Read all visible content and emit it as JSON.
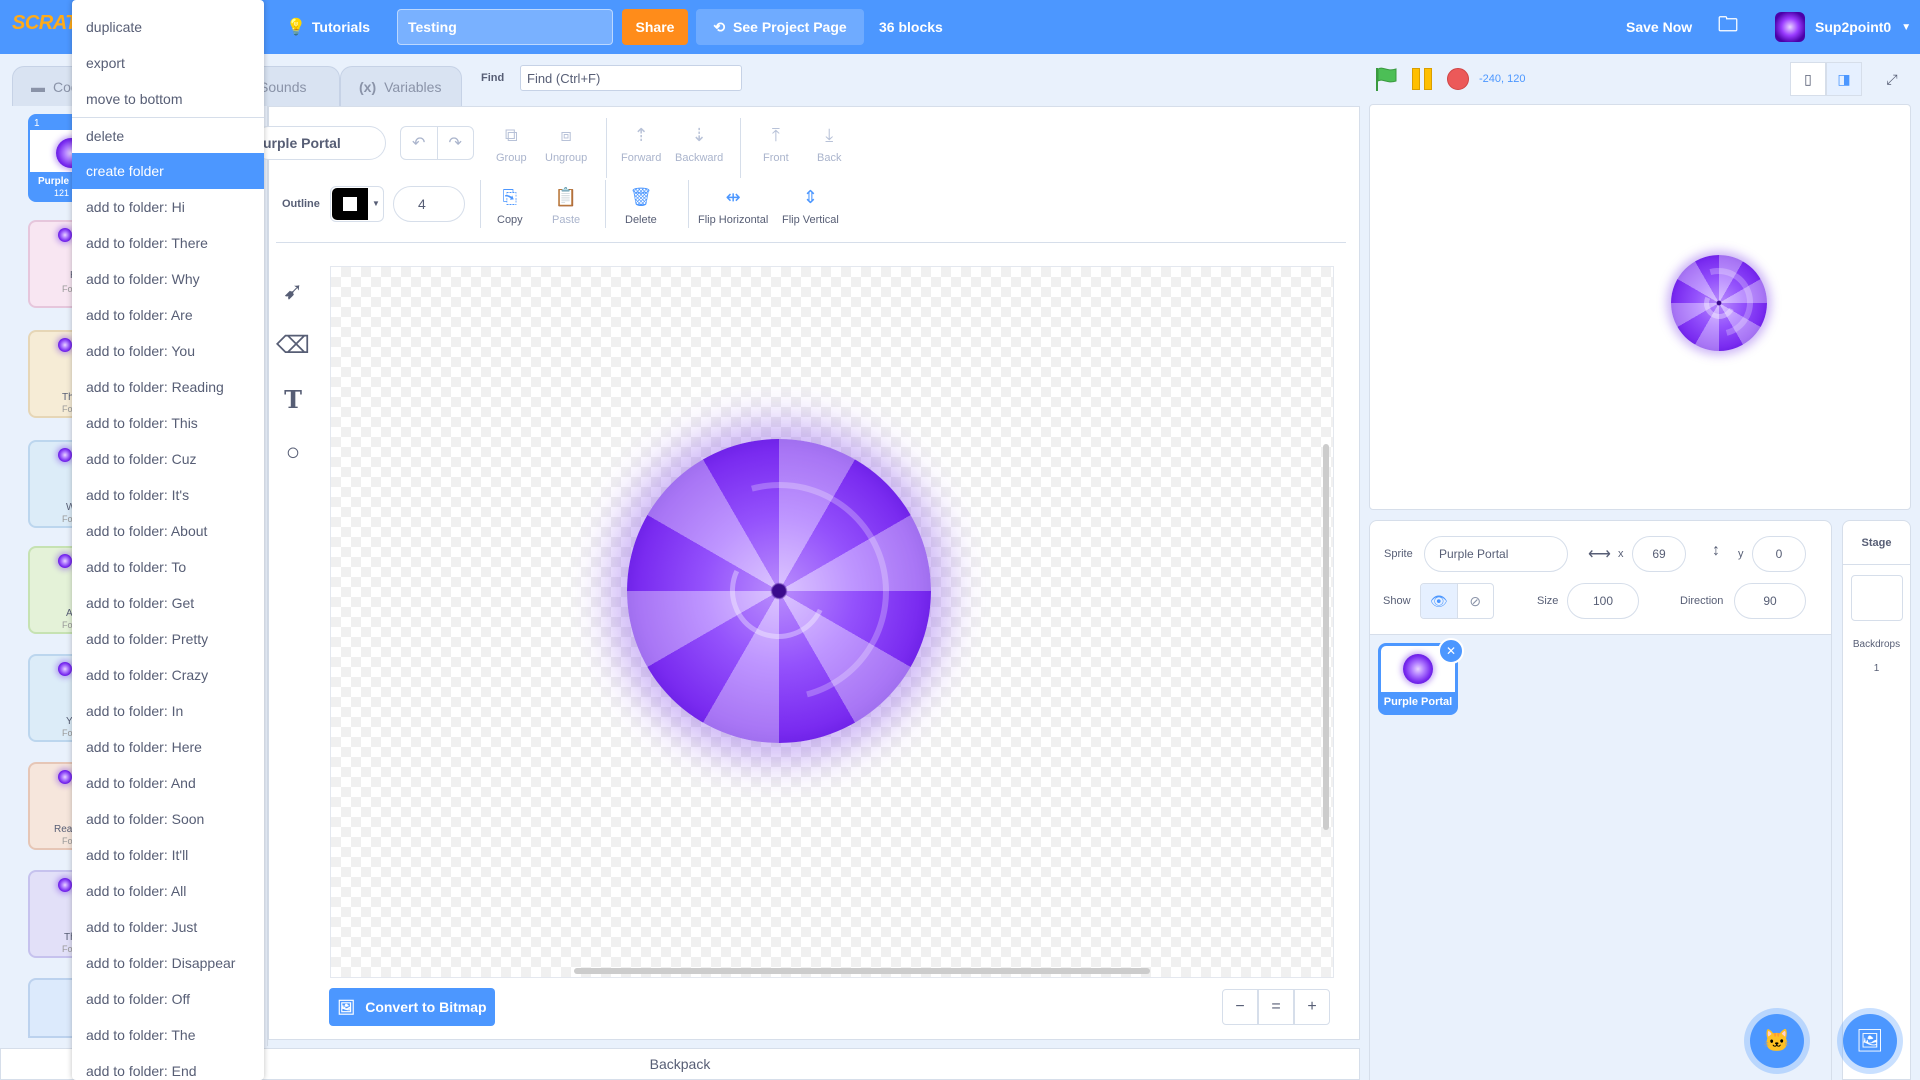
{
  "menubar": {
    "logo": "SCRATCH",
    "tutorials": "Tutorials",
    "project_title": "Testing",
    "share": "Share",
    "see_project_page": "See Project Page",
    "blocks_count": "36 blocks",
    "save_now": "Save Now",
    "username": "Sup2point0"
  },
  "tabs": {
    "code": "Code",
    "sounds": "Sounds",
    "variables": "Variables",
    "find_label": "Find",
    "find_placeholder": "Find (Ctrl+F)"
  },
  "costumes": [
    {
      "number": "1",
      "name": "Purple",
      "size": "121"
    },
    {
      "name": "H",
      "folder": "Fo"
    },
    {
      "name": "Th",
      "folder": "Fo"
    },
    {
      "name": "W",
      "folder": "Fo"
    },
    {
      "name": "A",
      "folder": "Fo"
    },
    {
      "name": "Y",
      "folder": "Fo"
    },
    {
      "name": "Rea",
      "folder": "Fo"
    },
    {
      "name": "Th",
      "folder": "Fo"
    }
  ],
  "editor": {
    "costume_name": "urple Portal",
    "tools": {
      "group": "Group",
      "ungroup": "Ungroup",
      "forward": "Forward",
      "backward": "Backward",
      "front": "Front",
      "back": "Back",
      "copy": "Copy",
      "paste": "Paste",
      "delete": "Delete",
      "flip_horizontal": "Flip Horizontal",
      "flip_vertical": "Flip Vertical"
    },
    "outline_label": "Outline",
    "outline_width": "4",
    "convert_button": "Convert to Bitmap",
    "zoom": {
      "out": "−",
      "reset": "=",
      "in": "+"
    }
  },
  "backpack": "Backpack",
  "stage": {
    "coords": "-240, 120"
  },
  "sprite_info": {
    "sprite_label": "Sprite",
    "sprite_name": "Purple Portal",
    "x_label": "x",
    "x_value": "69",
    "y_label": "y",
    "y_value": "0",
    "show_label": "Show",
    "size_label": "Size",
    "size_value": "100",
    "direction_label": "Direction",
    "direction_value": "90",
    "sprite_tile_name": "Purple Portal"
  },
  "stage_panel": {
    "header": "Stage",
    "backdrops_label": "Backdrops",
    "backdrops_count": "1"
  },
  "context_menu": {
    "items": [
      "duplicate",
      "export",
      "move to bottom",
      "delete",
      "create folder",
      "add to folder: Hi",
      "add to folder: There",
      "add to folder: Why",
      "add to folder: Are",
      "add to folder: You",
      "add to folder: Reading",
      "add to folder: This",
      "add to folder: Cuz",
      "add to folder: It's",
      "add to folder: About",
      "add to folder: To",
      "add to folder: Get",
      "add to folder: Pretty",
      "add to folder: Crazy",
      "add to folder: In",
      "add to folder: Here",
      "add to folder: And",
      "add to folder: Soon",
      "add to folder: It'll",
      "add to folder: All",
      "add to folder: Just",
      "add to folder: Disappear",
      "add to folder: Off",
      "add to folder: The",
      "add to folder: End"
    ],
    "highlighted": "create folder"
  },
  "colors": {
    "menu_blue": "#4c97ff",
    "share_orange": "#ff8c1a",
    "portal_purple": "#7a2cf0",
    "flag_green": "#4cbf56",
    "stop_red": "#ec5959"
  }
}
